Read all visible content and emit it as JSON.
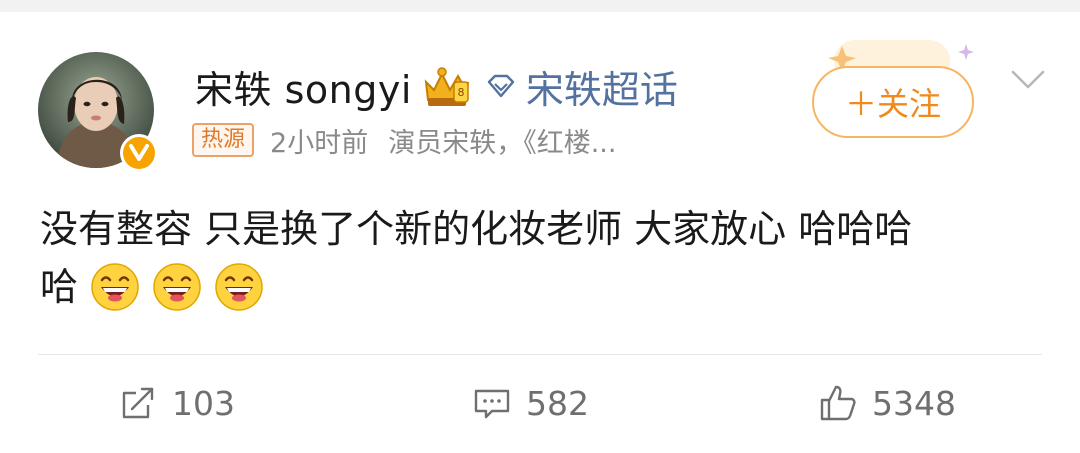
{
  "post": {
    "author": {
      "name": "宋轶 songyi",
      "verified": true
    },
    "topic_link": "宋轶超话",
    "source_tag": "热源",
    "time": "2小时前",
    "description": "演员宋轶，《红楼...",
    "follow_label": "＋关注",
    "content_line1": "没有整容 只是换了个新的化妆老师 大家放心 哈哈哈",
    "content_line2": "哈",
    "emojis": [
      "laughing-emoji",
      "laughing-emoji",
      "laughing-emoji"
    ]
  },
  "actions": {
    "repost_count": "103",
    "comment_count": "582",
    "like_count": "5348"
  },
  "colors": {
    "link": "#5372a0",
    "follow": "#f08a1c",
    "verified": "#f7a300",
    "meta": "#8a8a8a"
  }
}
